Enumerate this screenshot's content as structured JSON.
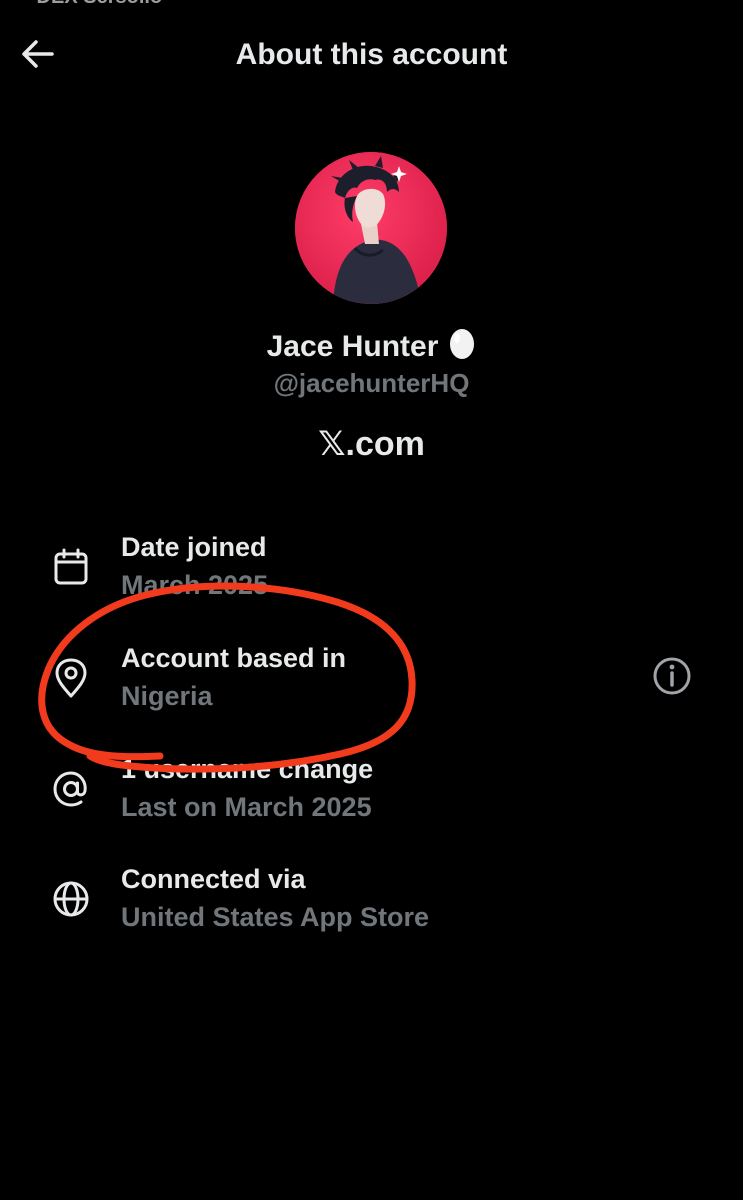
{
  "status_bar": {
    "cutoff_text": "• DEX Sersolio"
  },
  "header": {
    "title": "About this account",
    "back_icon": "arrow-left-icon"
  },
  "profile": {
    "display_name": "Jace Hunter",
    "badge_icon": "egg-icon",
    "handle": "@jacehunterHQ",
    "domain_prefix": "𝕏",
    "domain_suffix": ".com",
    "avatar_bg": "#ef2a57"
  },
  "details": [
    {
      "icon": "calendar-icon",
      "title": "Date joined",
      "value": "March 2025"
    },
    {
      "icon": "location-pin-icon",
      "title": "Account based in",
      "value": "Nigeria",
      "action_icon": "info-icon"
    },
    {
      "icon": "at-sign-icon",
      "title": "1 username change",
      "value": "Last on March 2025"
    },
    {
      "icon": "globe-icon",
      "title": "Connected via",
      "value": "United States App Store"
    }
  ],
  "colors": {
    "background": "#000000",
    "primary_text": "#e7e9ea",
    "secondary_text": "#71767b",
    "annotation": "#f23a1d"
  }
}
